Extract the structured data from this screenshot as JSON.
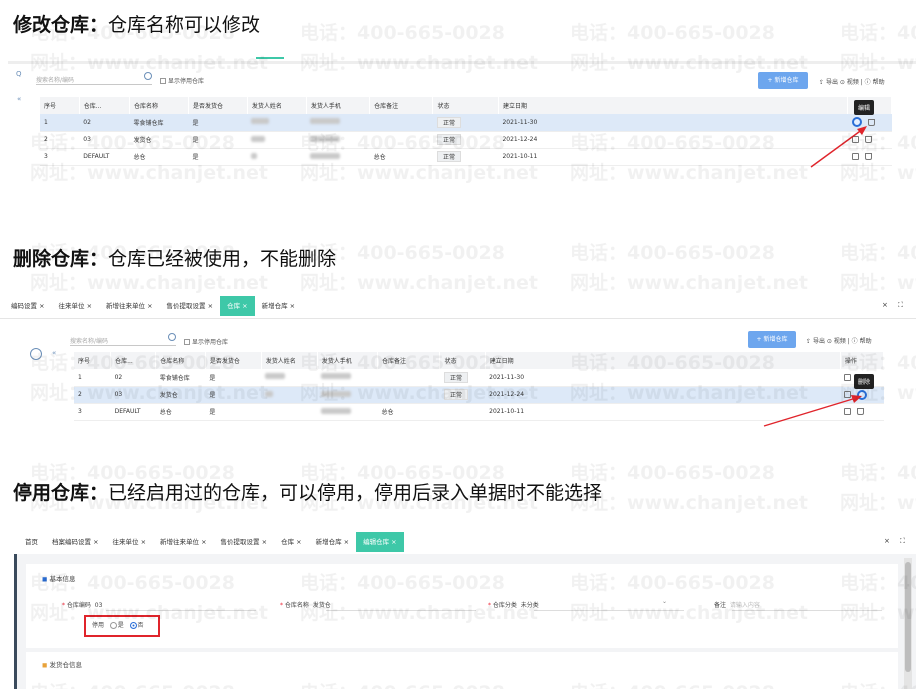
{
  "sections": {
    "edit": {
      "title_bold": "修改仓库",
      "title_sep": "：",
      "title_text": "仓库名称可以修改"
    },
    "delete": {
      "title_bold": "删除仓库",
      "title_sep": "：",
      "title_text": "仓库已经被使用，不能删除"
    },
    "disable": {
      "title_bold": "停用仓库",
      "title_sep": "：",
      "title_text": "已经启用过的仓库，可以停用，停用后录入单据时不能选择"
    }
  },
  "watermark": {
    "phone": "电话：400-665-0028",
    "site": "网址：www.chanjet.net"
  },
  "list_view": {
    "search_placeholder": "搜索名称/编码",
    "show_disabled_label": "显示停用仓库",
    "add_button": "+ 新增仓库",
    "export_label": "导出",
    "video_label": "视频",
    "help_label": "帮助",
    "columns": [
      "序号",
      "仓库...",
      "仓库名称",
      "是否发货仓",
      "发货人姓名",
      "发货人手机",
      "仓库备注",
      "状态",
      "建立日期",
      "操作"
    ],
    "rows": [
      {
        "no": "1",
        "code": "02",
        "name": "零食铺仓库",
        "ship": "是",
        "note": "",
        "status": "正常",
        "date": "2021-11-30"
      },
      {
        "no": "2",
        "code": "03",
        "name": "发货仓",
        "ship": "是",
        "note": "",
        "status": "正常",
        "date": "2021-12-24"
      },
      {
        "no": "3",
        "code": "DEFAULT",
        "name": "总仓",
        "ship": "是",
        "note": "总仓",
        "status": "正常",
        "date": "2021-10-11"
      }
    ],
    "edit_tooltip": "编辑",
    "delete_tooltip": "删除"
  },
  "tabs_delete": [
    "编码设置 ×",
    "往来单位 ×",
    "新增往来单位 ×",
    "售价提取设置 ×",
    "仓库 ×",
    "新增仓库 ×"
  ],
  "tabs_disable": [
    "首页",
    "档案编码设置 ×",
    "往来单位 ×",
    "新增往来单位 ×",
    "售价提取设置 ×",
    "仓库 ×",
    "新增仓库 ×",
    "编辑仓库 ×"
  ],
  "form": {
    "section_basic": "基本信息",
    "code_label": "仓库编码",
    "code_value": "03",
    "name_label": "仓库名称",
    "name_value": "发货仓",
    "category_label": "仓库分类",
    "category_value": "未分类",
    "note_label": "备注",
    "note_placeholder": "请输入内容",
    "disable_label": "停用",
    "yes": "是",
    "no": "否",
    "section_ship": "发货仓信息"
  },
  "colors": {
    "accent": "#3ec8a8",
    "primary": "#6da6ee",
    "highlight": "#dde9f8",
    "red": "#e0242b"
  }
}
